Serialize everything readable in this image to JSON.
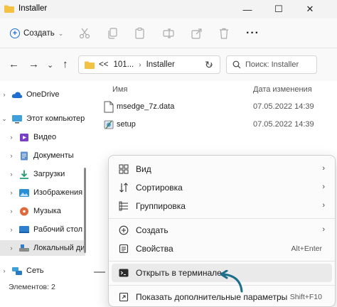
{
  "window": {
    "title": "Installer",
    "controls": {
      "minimize": "—",
      "maximize": "☐",
      "close": "✕"
    }
  },
  "toolbar": {
    "create_label": "Создать",
    "more_label": "···"
  },
  "address": {
    "crumbs": [
      "<<",
      "101...",
      "Installer"
    ],
    "search_placeholder": "Поиск: Installer"
  },
  "sidebar": {
    "items": [
      {
        "label": "OneDrive",
        "icon": "cloud-icon"
      },
      {
        "label": "Этот компьютер",
        "icon": "computer-icon"
      },
      {
        "label": "Видео",
        "icon": "video-icon"
      },
      {
        "label": "Документы",
        "icon": "documents-icon"
      },
      {
        "label": "Загрузки",
        "icon": "downloads-icon"
      },
      {
        "label": "Изображения",
        "icon": "pictures-icon"
      },
      {
        "label": "Музыка",
        "icon": "music-icon"
      },
      {
        "label": "Рабочий стол",
        "icon": "desktop-icon"
      },
      {
        "label": "Локальный ди",
        "icon": "drive-icon"
      },
      {
        "label": "Сеть",
        "icon": "network-icon"
      }
    ]
  },
  "filelist": {
    "columns": {
      "name": "Имя",
      "date": "Дата изменения"
    },
    "rows": [
      {
        "name": "msedge_7z.data",
        "date": "07.05.2022 14:39",
        "icon": "file-icon"
      },
      {
        "name": "setup",
        "date": "07.05.2022 14:39",
        "icon": "setup-icon"
      }
    ]
  },
  "status": {
    "items_count": "Элементов: 2"
  },
  "context_menu": {
    "items": [
      {
        "label": "Вид",
        "icon": "grid-icon",
        "submenu": "›"
      },
      {
        "label": "Сортировка",
        "icon": "sort-icon",
        "submenu": "›"
      },
      {
        "label": "Группировка",
        "icon": "group-icon",
        "submenu": "›"
      },
      {
        "label": "Создать",
        "icon": "new-icon",
        "submenu": "›"
      },
      {
        "label": "Свойства",
        "icon": "properties-icon",
        "shortcut": "Alt+Enter"
      },
      {
        "label": "Открыть в терминале",
        "icon": "terminal-icon"
      },
      {
        "label": "Показать дополнительные параметры",
        "icon": "more-options-icon",
        "shortcut": "Shift+F10"
      }
    ]
  },
  "colors": {
    "accent": "#1f6fd0",
    "folder": "#f4c242",
    "highlight": "#eaeaea",
    "arrow": "#1d6f8a"
  }
}
